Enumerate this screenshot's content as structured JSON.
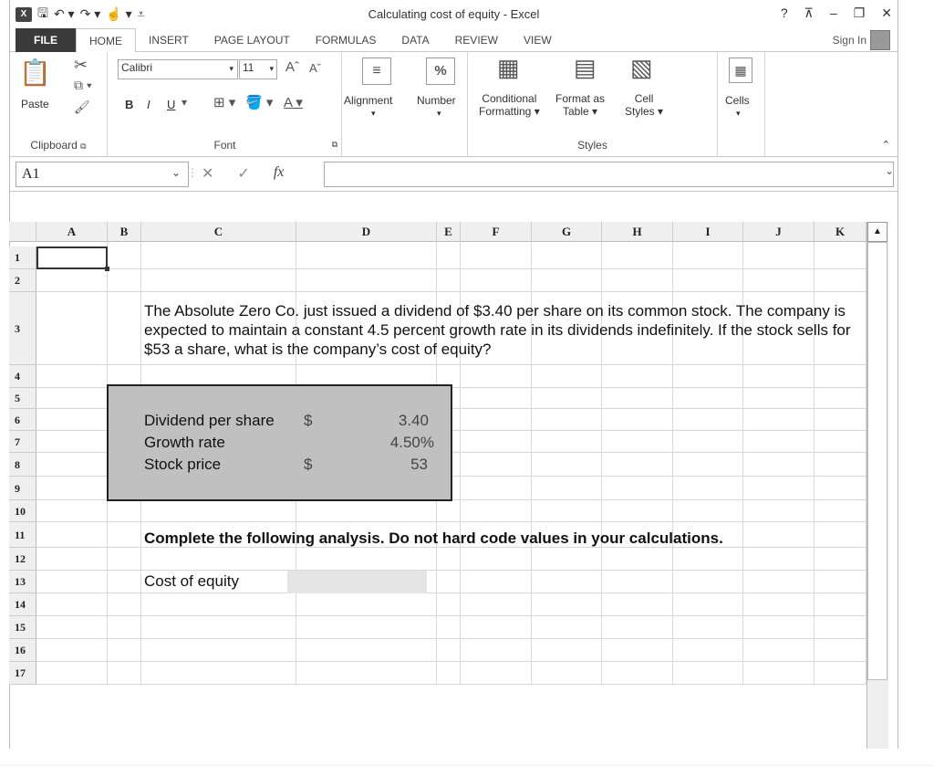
{
  "window": {
    "title": "Calculating cost of equity - Excel",
    "help": "?",
    "controls": [
      "⊼",
      "–",
      "❐",
      "✕"
    ]
  },
  "tabs": [
    "FILE",
    "HOME",
    "INSERT",
    "PAGE LAYOUT",
    "FORMULAS",
    "DATA",
    "REVIEW",
    "VIEW"
  ],
  "signin": "Sign In",
  "ribbon": {
    "clipboard": {
      "label": "Clipboard",
      "paste": "Paste"
    },
    "font": {
      "label": "Font",
      "name": "Calibri",
      "size": "11",
      "bold": "B",
      "italic": "I",
      "underline": "U"
    },
    "alignment": "Alignment",
    "number": "Number",
    "styles": {
      "label": "Styles",
      "conditional": "Conditional",
      "formatting": "Formatting",
      "format_as": "Format as",
      "table": "Table",
      "cell": "Cell",
      "cell_styles": "Styles"
    },
    "cells": "Cells"
  },
  "formula_bar": {
    "name_box": "A1",
    "fx": "fx",
    "value": ""
  },
  "columns": [
    "A",
    "B",
    "C",
    "D",
    "E",
    "F",
    "G",
    "H",
    "I",
    "J",
    "K"
  ],
  "rows": [
    "1",
    "2",
    "3",
    "4",
    "5",
    "6",
    "7",
    "8",
    "9",
    "10",
    "11",
    "12",
    "13",
    "14",
    "15",
    "16",
    "17"
  ],
  "sheet": {
    "problem": "The Absolute Zero Co. just issued a dividend of $3.40 per share on its common stock. The company is expected to maintain a constant 4.5 percent growth rate in its dividends indefinitely. If the stock sells for $53 a share, what is the company’s cost of equity?",
    "inputs": [
      {
        "label": "Dividend per share",
        "currency": "$",
        "value": "3.40"
      },
      {
        "label": "Growth rate",
        "currency": "",
        "value": "4.50%"
      },
      {
        "label": "Stock price",
        "currency": "$",
        "value": "53"
      }
    ],
    "instruction": "Complete the following analysis. Do not hard code values in your calculations.",
    "output_label": "Cost of equity",
    "output_value": ""
  }
}
